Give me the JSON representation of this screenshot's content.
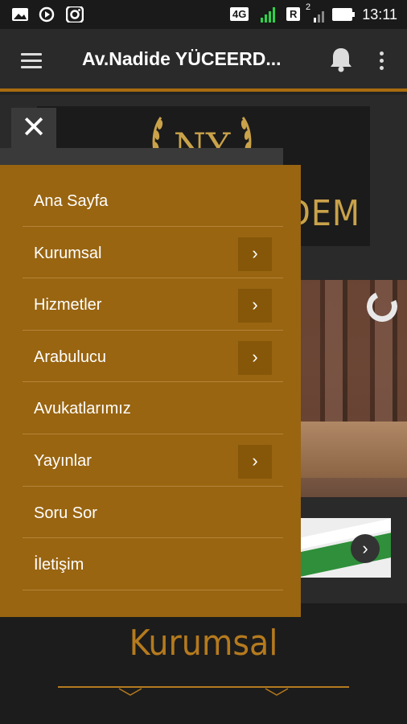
{
  "status_bar": {
    "time": "13:11",
    "network": "4G",
    "sim2": "R",
    "sim2_badge": "2",
    "left_icons": [
      "image-icon",
      "media-sync-icon",
      "instagram-icon"
    ]
  },
  "app_bar": {
    "title": "Av.Nadide YÜCEERD...",
    "icons": [
      "hamburger-menu-icon",
      "bell-icon",
      "more-vert-icon"
    ]
  },
  "drawer": {
    "close_symbol": "✕",
    "chevron_symbol": "›",
    "items": [
      {
        "label": "Ana Sayfa",
        "has_submenu": false
      },
      {
        "label": "Kurumsal",
        "has_submenu": true
      },
      {
        "label": "Hizmetler",
        "has_submenu": true
      },
      {
        "label": "Arabulucu",
        "has_submenu": true
      },
      {
        "label": "Avukatlarımız",
        "has_submenu": false
      },
      {
        "label": "Yayınlar",
        "has_submenu": true
      },
      {
        "label": "Soru Sor",
        "has_submenu": false
      },
      {
        "label": "İletişim",
        "has_submenu": false
      }
    ]
  },
  "background": {
    "logo_letters": "NY",
    "logo_text_fragment": "DEM",
    "section_title": "Kurumsal",
    "slider_next_symbol": "›"
  },
  "colors": {
    "accent": "#996511",
    "accent_dark": "#865709",
    "section_title": "#b57a1e",
    "appbar": "#2a2a2a"
  }
}
